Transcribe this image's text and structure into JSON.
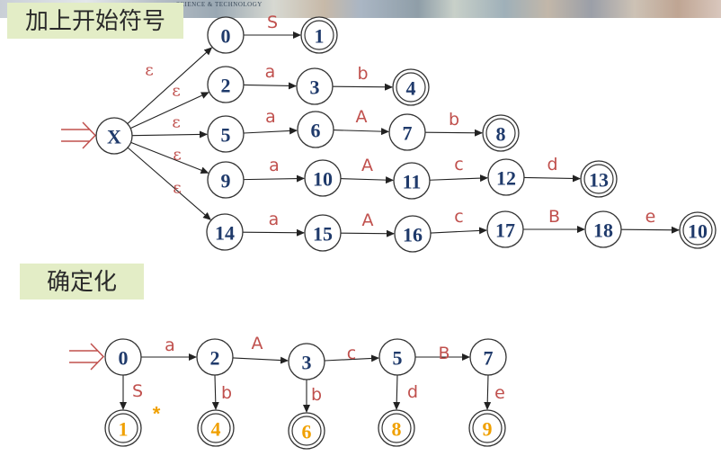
{
  "header": {
    "banner_text": "SCIENCE & TECHNOLOGY"
  },
  "sections": {
    "nfa_title": "加上开始符号",
    "dfa_title": "确定化"
  },
  "colors": {
    "node_text": "#1f3a6b",
    "edge_label": "#c0504d",
    "dfa_final_text": "#f0a000",
    "label_background": "#e3edc6"
  },
  "nfa": {
    "start_node": "X",
    "epsilon": "ε",
    "nodes": [
      {
        "id": "X",
        "final": false
      },
      {
        "id": "0",
        "final": false
      },
      {
        "id": "1",
        "final": true
      },
      {
        "id": "2",
        "final": false
      },
      {
        "id": "3",
        "final": false
      },
      {
        "id": "4",
        "final": true
      },
      {
        "id": "5",
        "final": false
      },
      {
        "id": "6",
        "final": false
      },
      {
        "id": "7",
        "final": false
      },
      {
        "id": "8",
        "final": true
      },
      {
        "id": "9",
        "final": false
      },
      {
        "id": "10",
        "final": false
      },
      {
        "id": "11",
        "final": false
      },
      {
        "id": "12",
        "final": false
      },
      {
        "id": "13",
        "final": true
      },
      {
        "id": "14",
        "final": false
      },
      {
        "id": "15",
        "final": false
      },
      {
        "id": "16",
        "final": false
      },
      {
        "id": "17",
        "final": false
      },
      {
        "id": "18",
        "final": false
      },
      {
        "id": "10",
        "final": true
      }
    ],
    "edges": [
      {
        "from": "X",
        "to": "0",
        "label": "ε"
      },
      {
        "from": "X",
        "to": "2",
        "label": "ε"
      },
      {
        "from": "X",
        "to": "5",
        "label": "ε"
      },
      {
        "from": "X",
        "to": "9",
        "label": "ε"
      },
      {
        "from": "X",
        "to": "14",
        "label": "ε"
      },
      {
        "from": "0",
        "to": "1",
        "label": "S"
      },
      {
        "from": "2",
        "to": "3",
        "label": "a"
      },
      {
        "from": "3",
        "to": "4",
        "label": "b"
      },
      {
        "from": "5",
        "to": "6",
        "label": "a"
      },
      {
        "from": "6",
        "to": "7",
        "label": "A"
      },
      {
        "from": "7",
        "to": "8",
        "label": "b"
      },
      {
        "from": "9",
        "to": "10",
        "label": "a"
      },
      {
        "from": "10",
        "to": "11",
        "label": "A"
      },
      {
        "from": "11",
        "to": "12",
        "label": "c"
      },
      {
        "from": "12",
        "to": "13",
        "label": "d"
      },
      {
        "from": "14",
        "to": "15",
        "label": "a"
      },
      {
        "from": "15",
        "to": "16",
        "label": "A"
      },
      {
        "from": "16",
        "to": "17",
        "label": "c"
      },
      {
        "from": "17",
        "to": "18",
        "label": "B"
      },
      {
        "from": "18",
        "to": "10",
        "label": "e"
      }
    ]
  },
  "dfa": {
    "main_nodes": [
      "0",
      "2",
      "3",
      "5",
      "7"
    ],
    "main_edges": [
      "a",
      "A",
      "c",
      "B"
    ],
    "final_nodes": [
      "1",
      "4",
      "6",
      "8",
      "9"
    ],
    "down_edges": [
      "S",
      "b",
      "b",
      "d",
      "e"
    ],
    "star": "*"
  }
}
